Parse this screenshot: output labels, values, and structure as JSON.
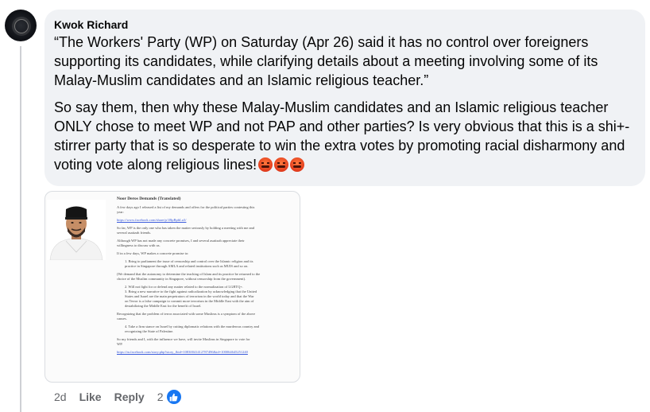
{
  "comment": {
    "author": "Kwok Richard",
    "paragraph_1": "“The Workers' Party (WP) on Saturday (Apr 26) said it has no control over foreigners supporting its candidates, while clarifying details about a meeting involving some of its Malay-Muslim candidates and an Islamic religious teacher.”",
    "paragraph_2": "So say them, then why these Malay-Muslim candidates and an Islamic religious teacher ONLY chose to meet WP and not PAP and other parties? Is very obvious that this is a shi+-stirrer party that is so desperate to win the extra votes by promoting racial disharmony and voting vote along religious lines!",
    "emojis": [
      "angry-face",
      "angry-face",
      "angry-face"
    ]
  },
  "attachment": {
    "title": "Noor Deros Demands (Translated)",
    "lines": [
      "A few days ago I released a list of my demands and offers for the political parties contesting this",
      "year:",
      "https://www.facebook.com/share/p/1BpBpbLu3/",
      "So far, WP is the only one who has taken the matter seriously by holding a meeting with me and",
      "several asatizah friends.",
      "Although WP has not made any concrete promises, I and several asatizah appreciate their",
      "willingness to discuss with us.",
      "If in a few days, WP makes a concrete promise to:",
      "1. Bring to parliament the issue of censorship and control over the Islamic religion and its",
      "practice in Singapore through AMLA and related institutions such as MUIS and so on.",
      "(We demand that the autonomy to determine the teaching of Islam and its practice be returned to the",
      "choice of the Muslim community in Singapore, without censorship from the government).",
      "2. Will not fight for or defend any matter related to the normalization of LGBTQ+.",
      "3. Bring a new narrative to the fight against radicalization by acknowledging that the United",
      "States and Israel are the main perpetrators of terrorism in the world today and that the War",
      "on Terror is a false campaign to commit more terrorism in the Middle East with the aim of",
      "destabilizing the Middle East for the benefit of Israel.",
      "Recognizing that the problem of terror associated with some Muslims is a symptom of the above",
      "causes.",
      "4. Take a firm stance on Israel by cutting diplomatic relations with the murderous country and",
      "recognizing the State of Palestine.",
      "So my friends and I, with the influence we have, will invite Muslims in Singapore to vote for",
      "WP.",
      "https://m.facebook.com/story.php?story_fbid=10830041412787496&id=100064645251240"
    ]
  },
  "actions": {
    "time": "2d",
    "like": "Like",
    "reply": "Reply",
    "reaction_count": "2"
  }
}
